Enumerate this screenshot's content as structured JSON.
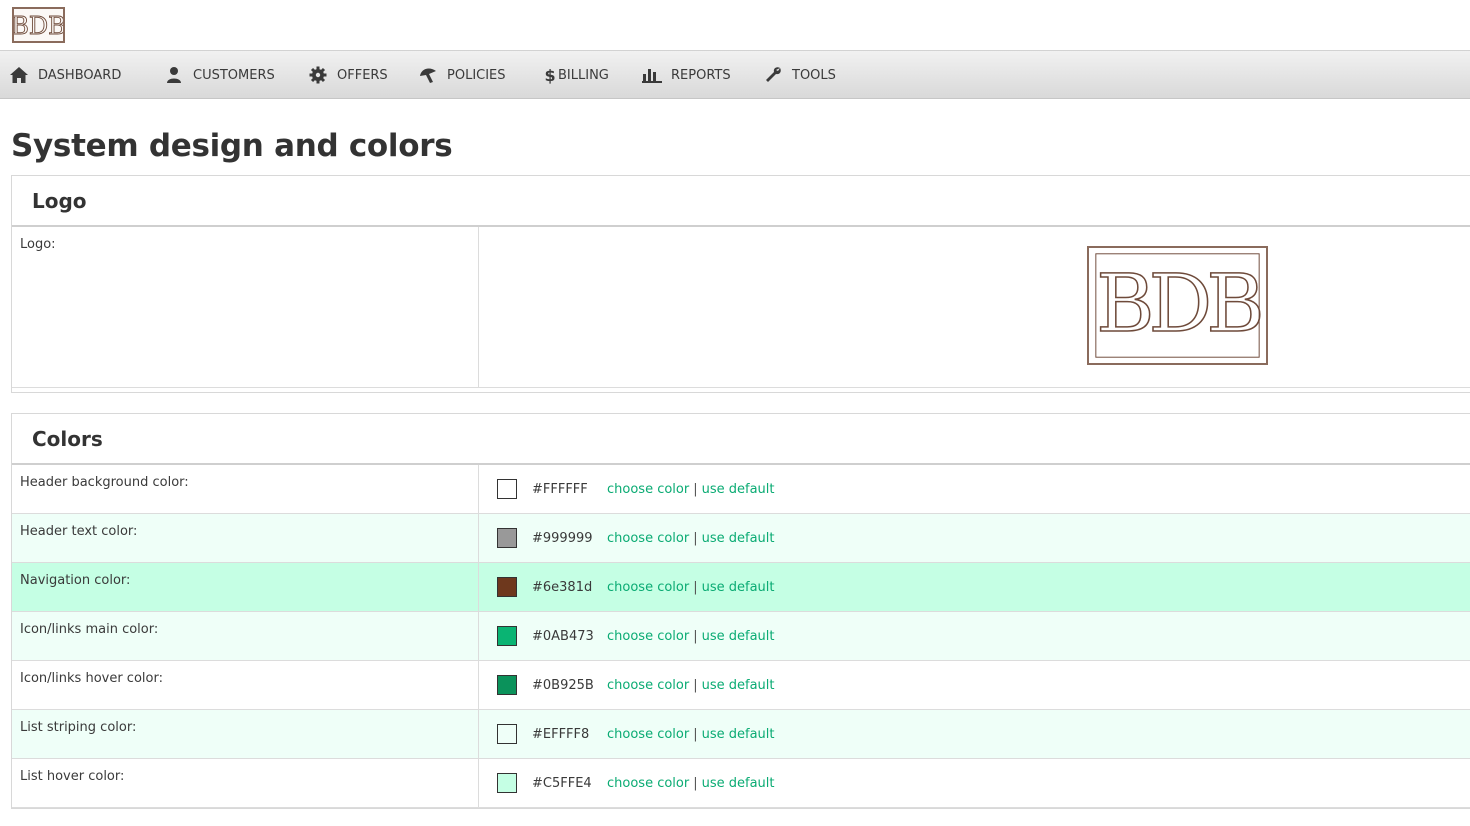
{
  "header": {
    "logo_text": "BDB"
  },
  "nav": {
    "items": [
      {
        "label": "DASHBOARD",
        "icon": "home-icon"
      },
      {
        "label": "CUSTOMERS",
        "icon": "user-icon"
      },
      {
        "label": "OFFERS",
        "icon": "gear-icon"
      },
      {
        "label": "POLICIES",
        "icon": "umbrella-icon"
      },
      {
        "label": "BILLING",
        "icon": "dollar-icon",
        "glyph": "$"
      },
      {
        "label": "REPORTS",
        "icon": "bar-chart-icon"
      },
      {
        "label": "TOOLS",
        "icon": "wrench-icon"
      }
    ]
  },
  "page": {
    "title": "System design and colors"
  },
  "logo_panel": {
    "heading": "Logo",
    "label": "Logo:",
    "logo_text": "BDB"
  },
  "colors_panel": {
    "heading": "Colors",
    "choose_label": "choose color",
    "separator": "|",
    "default_label": "use default",
    "rows": [
      {
        "label": "Header background color:",
        "value": "#FFFFFF",
        "swatch": "#FFFFFF",
        "row_bg": "#FFFFFF"
      },
      {
        "label": "Header text color:",
        "value": "#999999",
        "swatch": "#999999",
        "row_bg": "#EFFFF8"
      },
      {
        "label": "Navigation color:",
        "value": "#6e381d",
        "swatch": "#6e381d",
        "row_bg": "#C5FFE4"
      },
      {
        "label": "Icon/links main color:",
        "value": "#0AB473",
        "swatch": "#0AB473",
        "row_bg": "#EFFFF8"
      },
      {
        "label": "Icon/links hover color:",
        "value": "#0B925B",
        "swatch": "#0B925B",
        "row_bg": "#FFFFFF"
      },
      {
        "label": "List striping color:",
        "value": "#EFFFF8",
        "swatch": "#EFFFF8",
        "row_bg": "#EFFFF8"
      },
      {
        "label": "List hover color:",
        "value": "#C5FFE4",
        "swatch": "#C5FFE4",
        "row_bg": "#FFFFFF"
      }
    ]
  },
  "colors": {
    "accent": "#0AB473",
    "logo_brown": "#8a6b5c"
  }
}
